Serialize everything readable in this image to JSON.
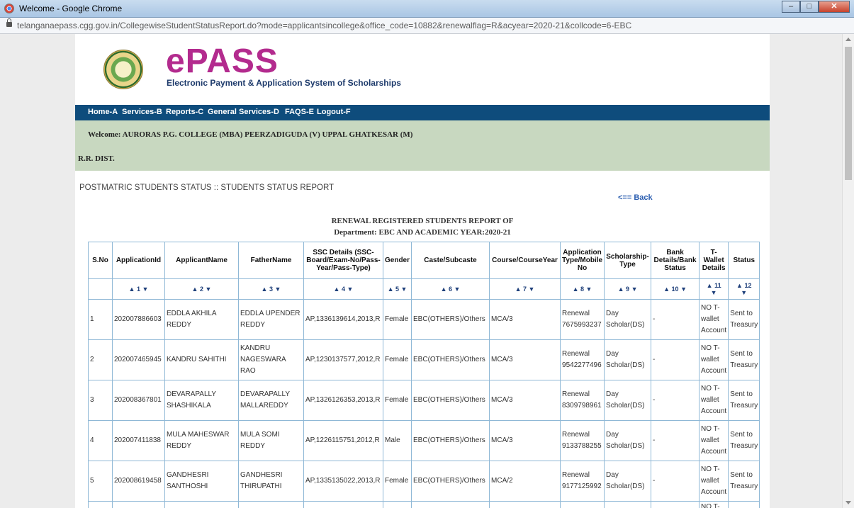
{
  "window": {
    "title": "Welcome - Google Chrome"
  },
  "browser": {
    "url": "telanganaepass.cgg.gov.in/CollegewiseStudentStatusReport.do?mode=applicantsincollege&office_code=10882&renewalflag=R&acyear=2020-21&collcode=6-EBC"
  },
  "header": {
    "logo": "ePASS",
    "tagline": "Electronic Payment & Application System of Scholarships",
    "brand_color": "#b32b8e",
    "nav_color": "#0e4c7c"
  },
  "menu": [
    "Home-A",
    "Services-B",
    "Reports-C",
    "General Services-D",
    "FAQS-E",
    "Logout-F"
  ],
  "welcome": {
    "line1": "Welcome: AURORAS P.G. COLLEGE (MBA) PEERZADIGUDA (V) UPPAL GHATKESAR (M)",
    "line2": "R.R. DIST."
  },
  "section_title": "POSTMATRIC STUDENTS STATUS :: STUDENTS STATUS REPORT",
  "back_link": "<== Back",
  "report": {
    "title": "RENEWAL REGISTERED STUDENTS REPORT OF",
    "subtitle": "Department: EBC AND ACADEMIC YEAR:2020-21"
  },
  "table": {
    "columns": [
      "S.No",
      "ApplicationId",
      "ApplicantName",
      "FatherName",
      "SSC Details (SSC-Board/Exam-No/Pass-Year/Pass-Type)",
      "Gender",
      "Caste/Subcaste",
      "Course/CourseYear",
      "Application Type/Mobile No",
      "Scholarship-Type",
      "Bank Details/Bank Status",
      "T-Wallet Details",
      "Status"
    ],
    "sort_numbers": [
      "1",
      "2",
      "3",
      "4",
      "5",
      "6",
      "7",
      "8",
      "9",
      "10",
      "11",
      "12"
    ],
    "rows": [
      {
        "sno": "1",
        "appid": "202007886603",
        "name": "EDDLA AKHILA REDDY",
        "father": "EDDLA UPENDER REDDY",
        "ssc": "AP,1336139614,2013,R",
        "gender": "Female",
        "caste": "EBC(OTHERS)/Others",
        "course": "MCA/3",
        "apptype": "Renewal 7675993237",
        "scholarship": "Day Scholar(DS)",
        "bank": "-",
        "twallet": "NO T-wallet Account",
        "status": "Sent to Treasury"
      },
      {
        "sno": "2",
        "appid": "202007465945",
        "name": "KANDRU SAHITHI",
        "father": "KANDRU NAGESWARA RAO",
        "ssc": "AP,1230137577,2012,R",
        "gender": "Female",
        "caste": "EBC(OTHERS)/Others",
        "course": "MCA/3",
        "apptype": "Renewal 9542277496",
        "scholarship": "Day Scholar(DS)",
        "bank": "-",
        "twallet": "NO T-wallet Account",
        "status": "Sent to Treasury"
      },
      {
        "sno": "3",
        "appid": "202008367801",
        "name": "DEVARAPALLY SHASHIKALA",
        "father": "DEVARAPALLY MALLAREDDY",
        "ssc": "AP,1326126353,2013,R",
        "gender": "Female",
        "caste": "EBC(OTHERS)/Others",
        "course": "MCA/3",
        "apptype": "Renewal 8309798961",
        "scholarship": "Day Scholar(DS)",
        "bank": "-",
        "twallet": "NO T-wallet Account",
        "status": "Sent to Treasury"
      },
      {
        "sno": "4",
        "appid": "202007411838",
        "name": "MULA MAHESWAR REDDY",
        "father": "MULA SOMI REDDY",
        "ssc": "AP,1226115751,2012,R",
        "gender": "Male",
        "caste": "EBC(OTHERS)/Others",
        "course": "MCA/3",
        "apptype": "Renewal 9133788255",
        "scholarship": "Day Scholar(DS)",
        "bank": "-",
        "twallet": "NO T-wallet Account",
        "status": "Sent to Treasury"
      },
      {
        "sno": "5",
        "appid": "202008619458",
        "name": "GANDHESRI SANTHOSHI",
        "father": "GANDHESRI THIRUPATHI",
        "ssc": "AP,1335135022,2013,R",
        "gender": "Female",
        "caste": "EBC(OTHERS)/Others",
        "course": "MCA/2",
        "apptype": "Renewal 9177125992",
        "scholarship": "Day Scholar(DS)",
        "bank": "-",
        "twallet": "NO T-wallet Account",
        "status": "Sent to Treasury"
      }
    ],
    "partial_row": {
      "twallet": "NO T-"
    }
  }
}
